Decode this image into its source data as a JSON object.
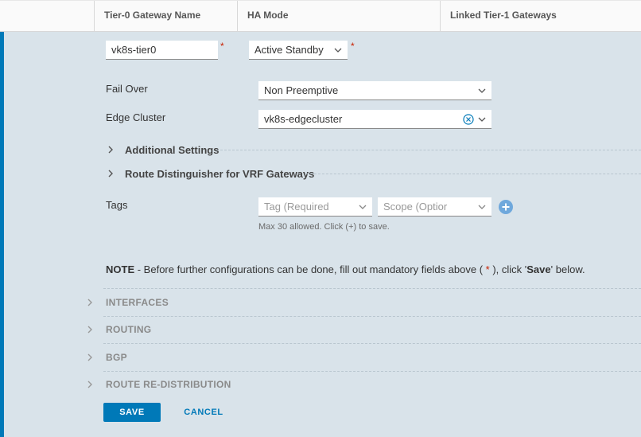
{
  "header": {
    "col_name": "Tier-0 Gateway Name",
    "col_ha": "HA Mode",
    "col_linked": "Linked Tier-1 Gateways"
  },
  "form": {
    "name_value": "vk8s-tier0",
    "ha_mode_value": "Active Standby",
    "required_marker": "*",
    "fail_over_label": "Fail Over",
    "fail_over_value": "Non Preemptive",
    "edge_cluster_label": "Edge Cluster",
    "edge_cluster_value": "vk8s-edgecluster",
    "additional_settings": "Additional Settings",
    "route_distinguisher": "Route Distinguisher for VRF Gateways",
    "tags_label": "Tags",
    "tag_placeholder": "Tag (Required",
    "scope_placeholder": "Scope (Optior",
    "tags_hint": "Max 30 allowed. Click (+) to save."
  },
  "note": {
    "prefix": "NOTE",
    "text1": " - Before further configurations can be done, fill out mandatory fields above ( ",
    "star": "*",
    "text2": " ), click '",
    "save_word": "Save",
    "text3": "' below."
  },
  "sections": [
    {
      "label": "INTERFACES"
    },
    {
      "label": "ROUTING"
    },
    {
      "label": "BGP"
    },
    {
      "label": "ROUTE RE-DISTRIBUTION"
    }
  ],
  "buttons": {
    "save": "SAVE",
    "cancel": "CANCEL"
  },
  "colors": {
    "accent": "#0079b8",
    "panel_bg": "#d9e3ea",
    "required": "#c92100"
  }
}
